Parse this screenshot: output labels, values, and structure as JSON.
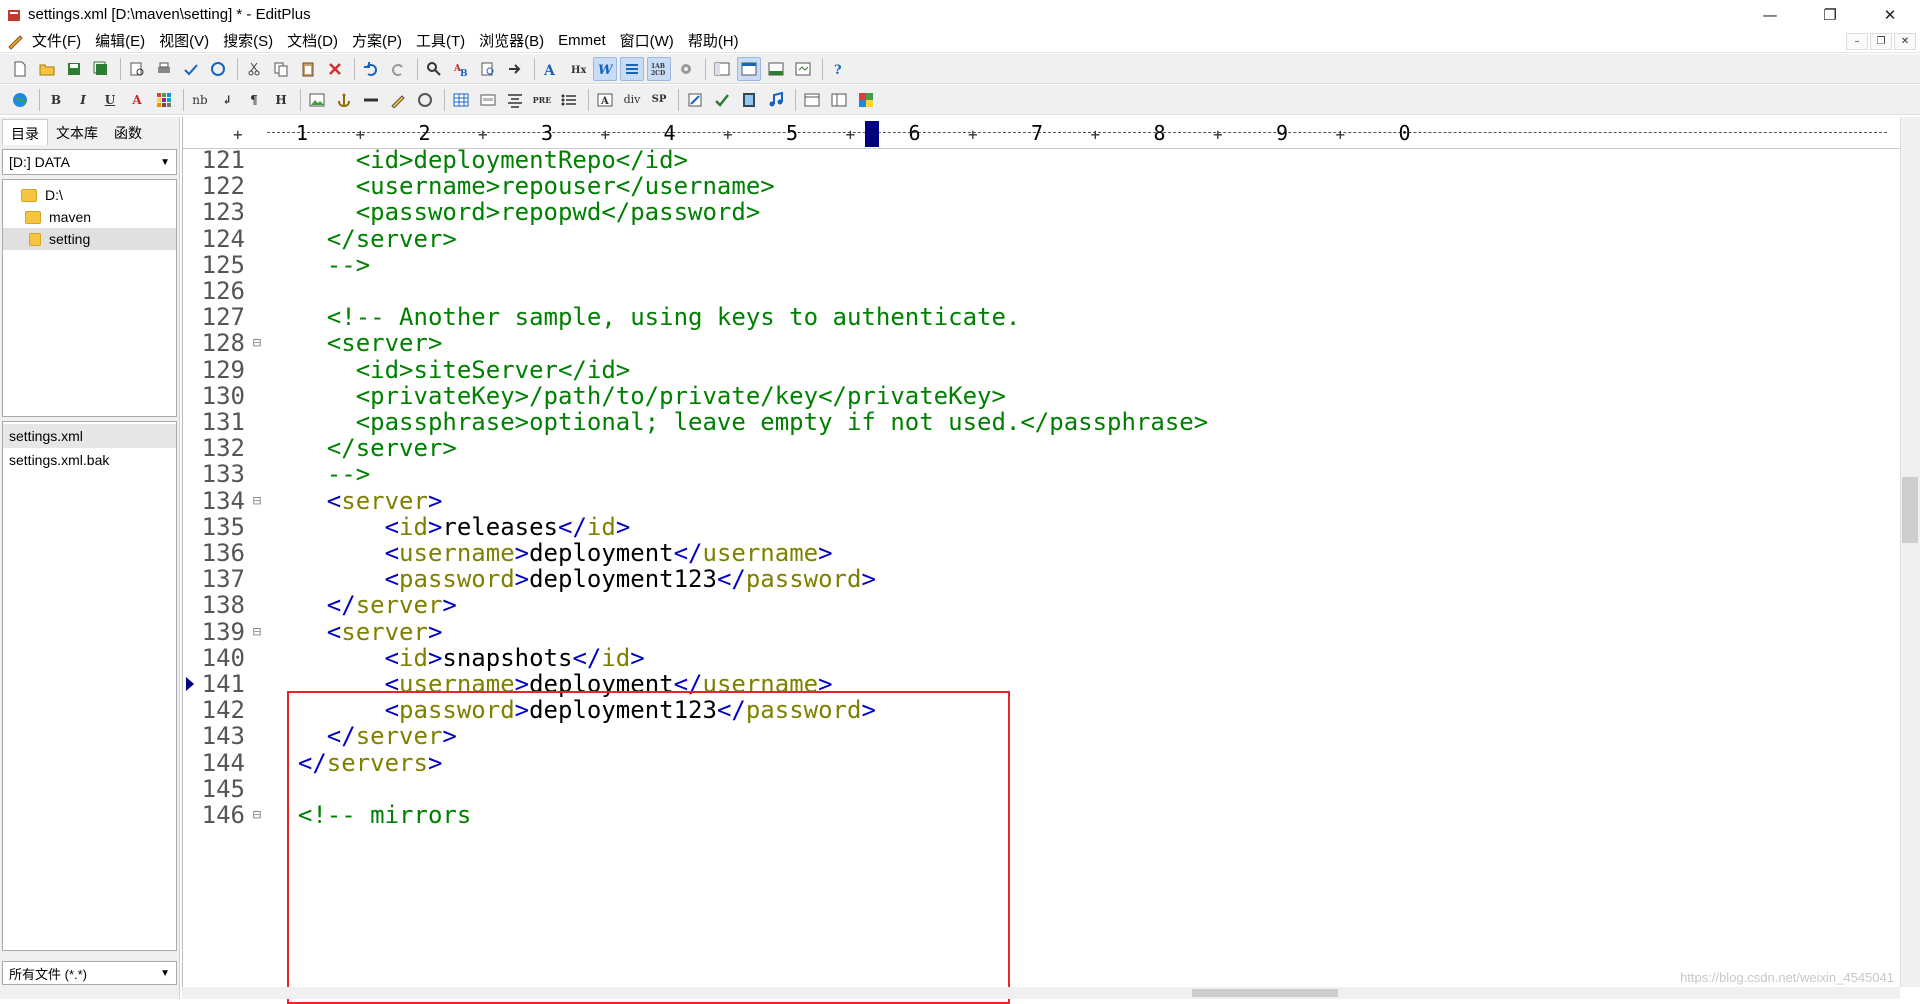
{
  "window": {
    "title": "settings.xml [D:\\maven\\setting] * - EditPlus",
    "minimize": "—",
    "maximize": "❐",
    "close": "✕"
  },
  "menu": {
    "items": [
      "文件(F)",
      "编辑(E)",
      "视图(V)",
      "搜索(S)",
      "文档(D)",
      "方案(P)",
      "工具(T)",
      "浏览器(B)",
      "Emmet",
      "窗口(W)",
      "帮助(H)"
    ]
  },
  "toolbar2": {
    "bold": "B",
    "italic": "I",
    "underline": "U",
    "font_color": "A",
    "nbsp": "nb",
    "br": "↲",
    "para": "¶",
    "heading": "H",
    "pre": "PRE",
    "div": "div",
    "span": "SP"
  },
  "left_panel": {
    "tabs": [
      "目录",
      "文本库",
      "函数"
    ],
    "drive": "[D:] DATA",
    "tree": [
      "D:\\",
      "maven",
      "setting"
    ],
    "files": [
      "settings.xml",
      "settings.xml.bak"
    ],
    "filter": "所有文件 (*.*)"
  },
  "ruler": {
    "numbers": [
      "1",
      "2",
      "3",
      "4",
      "5",
      "6",
      "7",
      "8",
      "9",
      "0"
    ]
  },
  "editor": {
    "lines": [
      {
        "n": "121",
        "fold": "",
        "segs": [
          [
            "code",
            "      <id>deploymentRepo</id>"
          ]
        ]
      },
      {
        "n": "122",
        "fold": "",
        "segs": [
          [
            "code",
            "      <username>repouser</username>"
          ]
        ]
      },
      {
        "n": "123",
        "fold": "",
        "segs": [
          [
            "code",
            "      <password>repopwd</password>"
          ]
        ]
      },
      {
        "n": "124",
        "fold": "",
        "segs": [
          [
            "code",
            "    </server>"
          ]
        ]
      },
      {
        "n": "125",
        "fold": "",
        "segs": [
          [
            "code",
            "    -->"
          ]
        ]
      },
      {
        "n": "126",
        "fold": "",
        "segs": [
          [
            "code",
            ""
          ]
        ]
      },
      {
        "n": "127",
        "fold": "",
        "segs": [
          [
            "code",
            "    <!-- Another sample, using keys to authenticate."
          ]
        ]
      },
      {
        "n": "128",
        "fold": "⊟",
        "segs": [
          [
            "code",
            "    <server>"
          ]
        ]
      },
      {
        "n": "129",
        "fold": "",
        "segs": [
          [
            "code",
            "      <id>siteServer</id>"
          ]
        ]
      },
      {
        "n": "130",
        "fold": "",
        "segs": [
          [
            "code",
            "      <privateKey>/path/to/private/key</privateKey>"
          ]
        ]
      },
      {
        "n": "131",
        "fold": "",
        "segs": [
          [
            "code",
            "      <passphrase>optional; leave empty if not used.</passphrase>"
          ]
        ]
      },
      {
        "n": "132",
        "fold": "",
        "segs": [
          [
            "code",
            "    </server>"
          ]
        ]
      },
      {
        "n": "133",
        "fold": "",
        "segs": [
          [
            "code",
            "    -->"
          ]
        ]
      },
      {
        "n": "134",
        "fold": "⊟",
        "segs": [
          [
            "tag",
            "    <"
          ],
          [
            "tname",
            "server"
          ],
          [
            "tag",
            ">"
          ]
        ]
      },
      {
        "n": "135",
        "fold": "",
        "segs": [
          [
            "tag",
            "        <"
          ],
          [
            "tname",
            "id"
          ],
          [
            "tag",
            ">"
          ],
          [
            "tval",
            "releases"
          ],
          [
            "tag",
            "</"
          ],
          [
            "tname",
            "id"
          ],
          [
            "tag",
            ">"
          ]
        ]
      },
      {
        "n": "136",
        "fold": "",
        "segs": [
          [
            "tag",
            "        <"
          ],
          [
            "tname",
            "username"
          ],
          [
            "tag",
            ">"
          ],
          [
            "tval",
            "deployment"
          ],
          [
            "tag",
            "</"
          ],
          [
            "tname",
            "username"
          ],
          [
            "tag",
            ">"
          ]
        ]
      },
      {
        "n": "137",
        "fold": "",
        "segs": [
          [
            "tag",
            "        <"
          ],
          [
            "tname",
            "password"
          ],
          [
            "tag",
            ">"
          ],
          [
            "tval",
            "deployment123"
          ],
          [
            "tag",
            "</"
          ],
          [
            "tname",
            "password"
          ],
          [
            "tag",
            ">"
          ]
        ]
      },
      {
        "n": "138",
        "fold": "",
        "segs": [
          [
            "tag",
            "    </"
          ],
          [
            "tname",
            "server"
          ],
          [
            "tag",
            ">"
          ]
        ]
      },
      {
        "n": "139",
        "fold": "⊟",
        "segs": [
          [
            "tag",
            "    <"
          ],
          [
            "tname",
            "server"
          ],
          [
            "tag",
            ">"
          ]
        ]
      },
      {
        "n": "140",
        "fold": "",
        "segs": [
          [
            "tag",
            "        <"
          ],
          [
            "tname",
            "id"
          ],
          [
            "tag",
            ">"
          ],
          [
            "tval",
            "snapshots"
          ],
          [
            "tag",
            "</"
          ],
          [
            "tname",
            "id"
          ],
          [
            "tag",
            ">"
          ]
        ]
      },
      {
        "n": "141",
        "fold": "",
        "segs": [
          [
            "tag",
            "        <"
          ],
          [
            "tname",
            "username"
          ],
          [
            "tag",
            ">"
          ],
          [
            "tval",
            "deployment"
          ],
          [
            "tag",
            "</"
          ],
          [
            "tname",
            "username"
          ],
          [
            "tag",
            ">"
          ]
        ]
      },
      {
        "n": "142",
        "fold": "",
        "segs": [
          [
            "tag",
            "        <"
          ],
          [
            "tname",
            "password"
          ],
          [
            "tag",
            ">"
          ],
          [
            "tval",
            "deployment123"
          ],
          [
            "tag",
            "</"
          ],
          [
            "tname",
            "password"
          ],
          [
            "tag",
            ">"
          ]
        ]
      },
      {
        "n": "143",
        "fold": "",
        "segs": [
          [
            "tag",
            "    </"
          ],
          [
            "tname",
            "server"
          ],
          [
            "tag",
            ">"
          ]
        ]
      },
      {
        "n": "144",
        "fold": "",
        "segs": [
          [
            "tag",
            "  </"
          ],
          [
            "tname",
            "servers"
          ],
          [
            "tag",
            ">"
          ]
        ]
      },
      {
        "n": "145",
        "fold": "",
        "segs": [
          [
            "code",
            ""
          ]
        ]
      },
      {
        "n": "146",
        "fold": "⊟",
        "segs": [
          [
            "code",
            "  <!-- mirrors"
          ]
        ]
      }
    ],
    "marker_line": "141"
  },
  "watermark": "https://blog.csdn.net/weixin_4545041"
}
